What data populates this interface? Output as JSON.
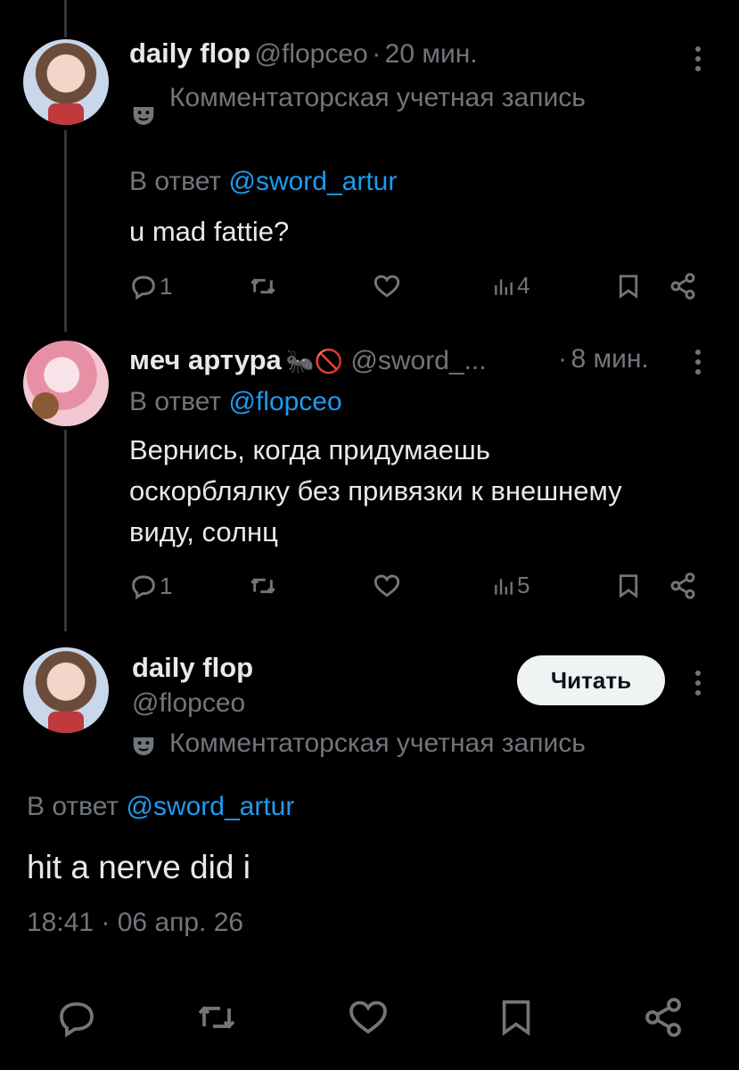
{
  "tweet1": {
    "name": "daily flop",
    "handle": "@flopceo",
    "dot": "·",
    "time": "20 мин.",
    "badge": "Комментаторская учетная запись",
    "reply_prefix": "В ответ",
    "reply_to": "@sword_artur",
    "text": "u mad fattie?",
    "replies": "1",
    "views": "4"
  },
  "tweet2": {
    "name": "меч артура",
    "emoji": "🐜🚫",
    "handle": "@sword_...",
    "dot": "·",
    "time": "8 мин.",
    "reply_prefix": "В ответ",
    "reply_to": "@flopceo",
    "text_line1": "Вернись, когда придумаешь",
    "text_line2": "оскорблялку без привязки к внешнему",
    "text_line3": "виду, солнц",
    "replies": "1",
    "views": "5"
  },
  "main": {
    "name": "daily flop",
    "handle": "@flopceo",
    "follow_label": "Читать",
    "badge": "Комментаторская учетная запись",
    "reply_prefix": "В ответ",
    "reply_to": "@sword_artur",
    "text": "hit a nerve did i",
    "timestamp": "18:41 · 06 апр. 26"
  },
  "icons": {
    "reply": "reply-icon",
    "retweet": "retweet-icon",
    "like": "heart-icon",
    "views": "views-icon",
    "bookmark": "bookmark-icon",
    "share": "share-icon",
    "badge": "mask-icon",
    "more": "more-icon"
  },
  "colors": {
    "background": "#000000",
    "text": "#e7e9ea",
    "muted": "#71767b",
    "link": "#1d9bf0",
    "button": "#eff3f4"
  }
}
